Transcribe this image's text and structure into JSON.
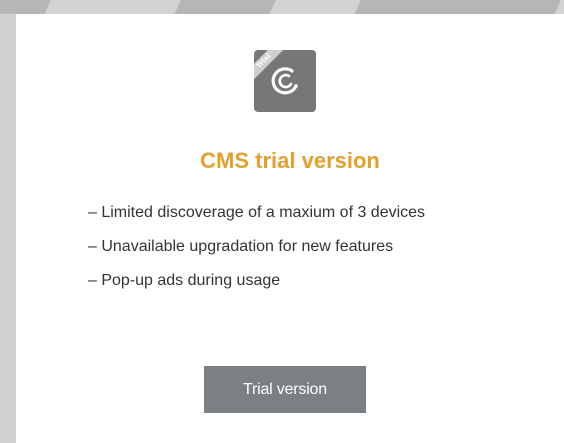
{
  "icon": {
    "name": "cms-logo-icon",
    "ribbon_text": "Trial"
  },
  "title": "CMS trial version",
  "features": [
    "– Limited discoverage of a maxium of 3 devices",
    "– Unavailable upgradation for new features",
    "– Pop-up ads during usage"
  ],
  "button": {
    "label": "Trial version"
  },
  "colors": {
    "title": "#e3a02b",
    "button_bg": "#7b8084",
    "icon_bg": "#777777",
    "body_text": "#333333",
    "backdrop": "#d0d0d0"
  }
}
